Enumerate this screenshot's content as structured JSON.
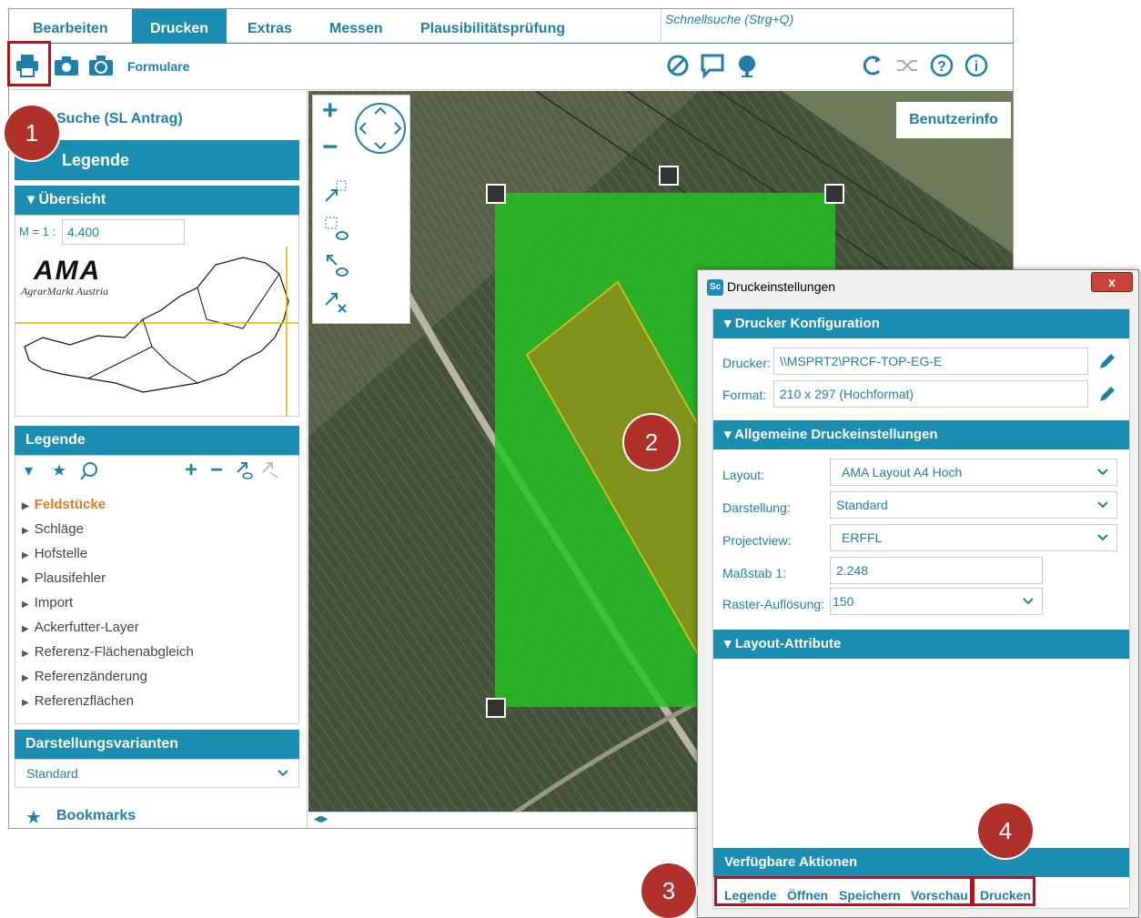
{
  "menu": {
    "items": [
      "Bearbeiten",
      "Drucken",
      "Extras",
      "Messen",
      "Plausibilitätsprüfung"
    ],
    "active": "Drucken",
    "quicksearch_placeholder": "Schnellsuche (Strg+Q)"
  },
  "toolbar": {
    "formulare_label": "Formulare",
    "icons": [
      "print-icon",
      "camera-icon",
      "camera-filled-icon",
      "no-entry-icon",
      "comment-icon",
      "globe-icon",
      "refresh-icon",
      "shuffle-icon",
      "help-icon",
      "info-icon"
    ]
  },
  "left": {
    "search_title": "Suche  (SL Antrag)",
    "legend_main": "Legende",
    "overview_title": "▾ Übersicht",
    "scale_label": "M = 1 :",
    "scale_value": "4.400",
    "logo_text": "AMA",
    "logo_sub": "AgrarMarkt Austria",
    "legend_title": "Legende",
    "legend_items": [
      "Feldstücke",
      "Schläge",
      "Hofstelle",
      "Plausifehler",
      "Import",
      "Ackerfutter-Layer",
      "Referenz-Flächenabgleich",
      "Referenzänderung",
      "Referenzflächen"
    ],
    "variants_title": "Darstellungsvarianten",
    "variants_value": "Standard",
    "bookmarks_label": "Bookmarks"
  },
  "map": {
    "benutzerinfo": "Benutzerinfo"
  },
  "badges": [
    "1",
    "2",
    "3",
    "4"
  ],
  "dialog": {
    "title": "Druckeinstellungen",
    "app_icon_text": "Sc",
    "close_label": "x",
    "sec_printer": "▾ Drucker Konfiguration",
    "drucker_label": "Drucker:",
    "drucker_value": "\\\\MSPRT2\\PRCF-TOP-EG-E",
    "format_label": "Format:",
    "format_value": "210 x 297 (Hochformat)",
    "sec_general": "▾ Allgemeine Druckeinstellungen",
    "layout_label": "Layout:",
    "layout_value": "AMA Layout A4 Hoch",
    "darstellung_label": "Darstellung:",
    "darstellung_value": "Standard",
    "projectview_label": "Projectview:",
    "projectview_value": "ERFFL",
    "massstab_label": "Maßstab 1:",
    "massstab_value": "2.248",
    "raster_label": "Raster-Auflösung:",
    "raster_value": "150",
    "sec_layout": "▾ Layout-Attribute",
    "sec_actions": "Verfügbare Aktionen",
    "actions": [
      "Legende",
      "Öffnen",
      "Speichern",
      "Vorschau",
      "Drucken"
    ]
  },
  "colors": {
    "accent": "#1a8db0",
    "highlight": "#b5121b",
    "badge": "#b0302a",
    "selection": "#22c322",
    "parcel": "#8a8f1a",
    "legend_active": "#e07a1e"
  }
}
